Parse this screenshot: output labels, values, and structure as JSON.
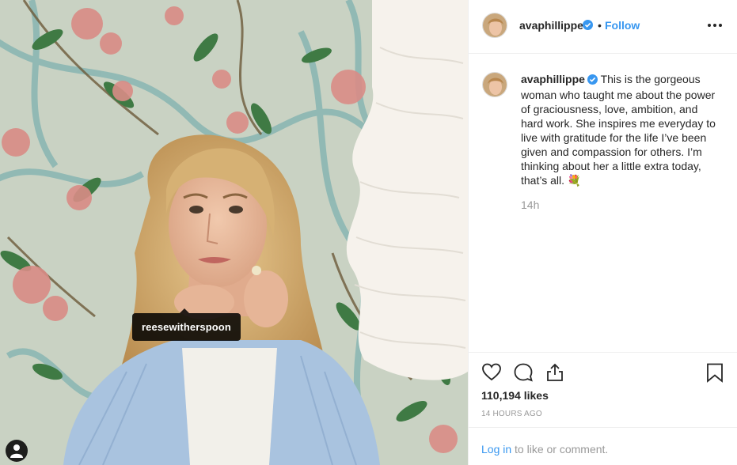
{
  "post": {
    "photo_tag": "reesewitherspoon",
    "photo_tag_icon": "tag-user-icon"
  },
  "header": {
    "username": "avaphillippe",
    "separator": "•",
    "follow_label": "Follow",
    "verified_icon": "verified-badge-icon",
    "more_icon": "more-options-icon"
  },
  "caption": {
    "username": "avaphillippe",
    "text": "This is the gorgeous woman who taught me about the power of graciousness, love, ambition, and hard work. She inspires me everyday to live with gratitude for the life I’ve been given and compassion for others. I’m thinking about her a little extra today, that’s all. 💐",
    "time": "14h"
  },
  "actions": {
    "icons": [
      "heart-icon",
      "comment-icon",
      "share-icon",
      "bookmark-icon"
    ],
    "likes": "110,194 likes",
    "posted_ago": "14 HOURS AGO"
  },
  "comment_bar": {
    "login_link": "Log in",
    "rest": " to like or comment."
  },
  "colors": {
    "accent": "#3897f0",
    "muted": "#999999",
    "text": "#262626",
    "divider": "#efefef"
  }
}
